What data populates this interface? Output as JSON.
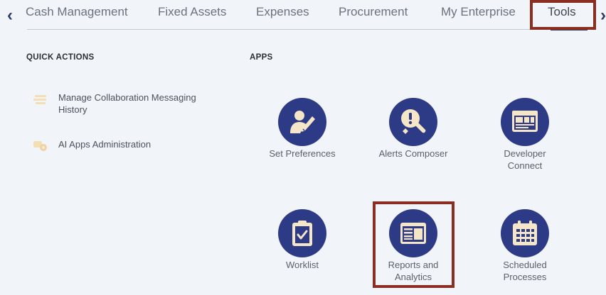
{
  "nav": {
    "tabs": [
      "Cash Management",
      "Fixed Assets",
      "Expenses",
      "Procurement",
      "My Enterprise",
      "Tools"
    ],
    "active_tab": "Tools",
    "prev_glyph": "‹",
    "next_glyph": "›"
  },
  "quick_actions": {
    "title": "QUICK ACTIONS",
    "items": [
      {
        "label": "Manage Collaboration Messaging History",
        "icon": "list-icon"
      },
      {
        "label": "AI Apps Administration",
        "icon": "ai-apps-icon"
      }
    ]
  },
  "apps": {
    "title": "APPS",
    "items": [
      {
        "label": "Set Preferences",
        "icon": "user-edit-icon"
      },
      {
        "label": "Alerts Composer",
        "icon": "alert-wrench-icon"
      },
      {
        "label": "Developer Connect",
        "icon": "developer-connect-icon"
      },
      {
        "label": "Worklist",
        "icon": "clipboard-check-icon"
      },
      {
        "label": "Reports and Analytics",
        "icon": "report-icon"
      },
      {
        "label": "Scheduled Processes",
        "icon": "calendar-icon"
      }
    ]
  },
  "colors": {
    "accent": "#2d3a86",
    "highlight": "#8b2e22",
    "icon_fill": "#f5e6c8"
  }
}
